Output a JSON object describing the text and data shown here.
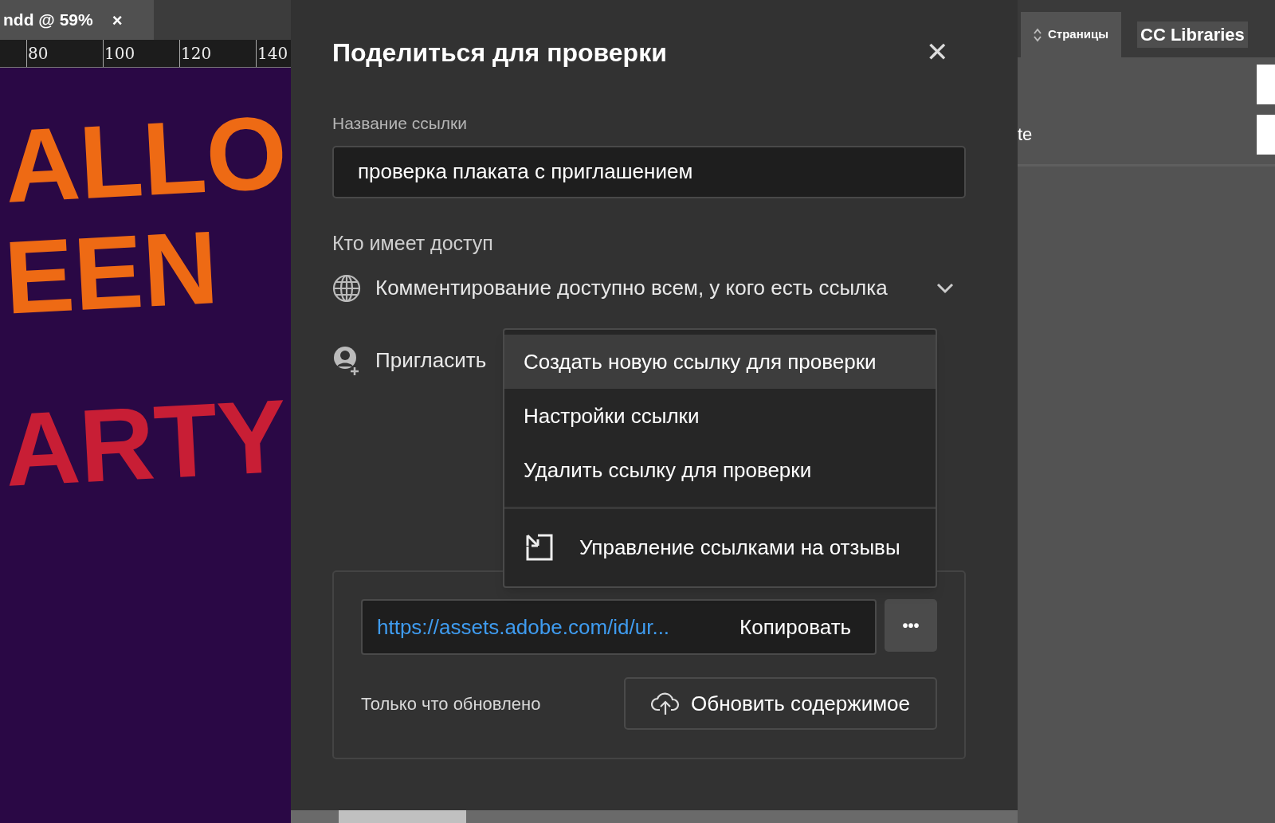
{
  "document_tab": {
    "title": "ndd @ 59%",
    "close": "×"
  },
  "ruler": {
    "labels": [
      "80",
      "100",
      "120",
      "140"
    ]
  },
  "poster": {
    "lines": [
      {
        "text": "ALLO",
        "color": "#ee6a14"
      },
      {
        "text": "EEN",
        "color": "#ee6a14"
      },
      {
        "text": "ARTY",
        "color": "#c81e35"
      }
    ]
  },
  "dialog": {
    "title": "Поделиться для проверки",
    "close": "✕",
    "link_name": {
      "label": "Название ссылки",
      "value": "проверка плаката с приглашением"
    },
    "access": {
      "label": "Кто имеет доступ",
      "value": "Комментирование доступно всем, у кого есть ссылка"
    },
    "invite": {
      "label": "Пригласить"
    },
    "menu": [
      {
        "label": "Создать новую ссылку для проверки",
        "selected": true,
        "kind": "plain"
      },
      {
        "label": "Настройки ссылки",
        "selected": false,
        "kind": "plain"
      },
      {
        "label": "Удалить ссылку для проверки",
        "selected": false,
        "kind": "plain"
      },
      {
        "label": "Управление ссылками на отзывы",
        "selected": false,
        "kind": "icon"
      }
    ],
    "link": {
      "url": "https://assets.adobe.com/id/ur...",
      "copy": "Копировать",
      "more": "•••"
    },
    "status": "Только что обновлено",
    "update_button": "Обновить содержимое"
  },
  "panel": {
    "tabs": [
      {
        "label": "Страницы",
        "selected": true
      },
      {
        "label": "CC Libraries",
        "selected": false
      }
    ],
    "partial_text": "te"
  }
}
